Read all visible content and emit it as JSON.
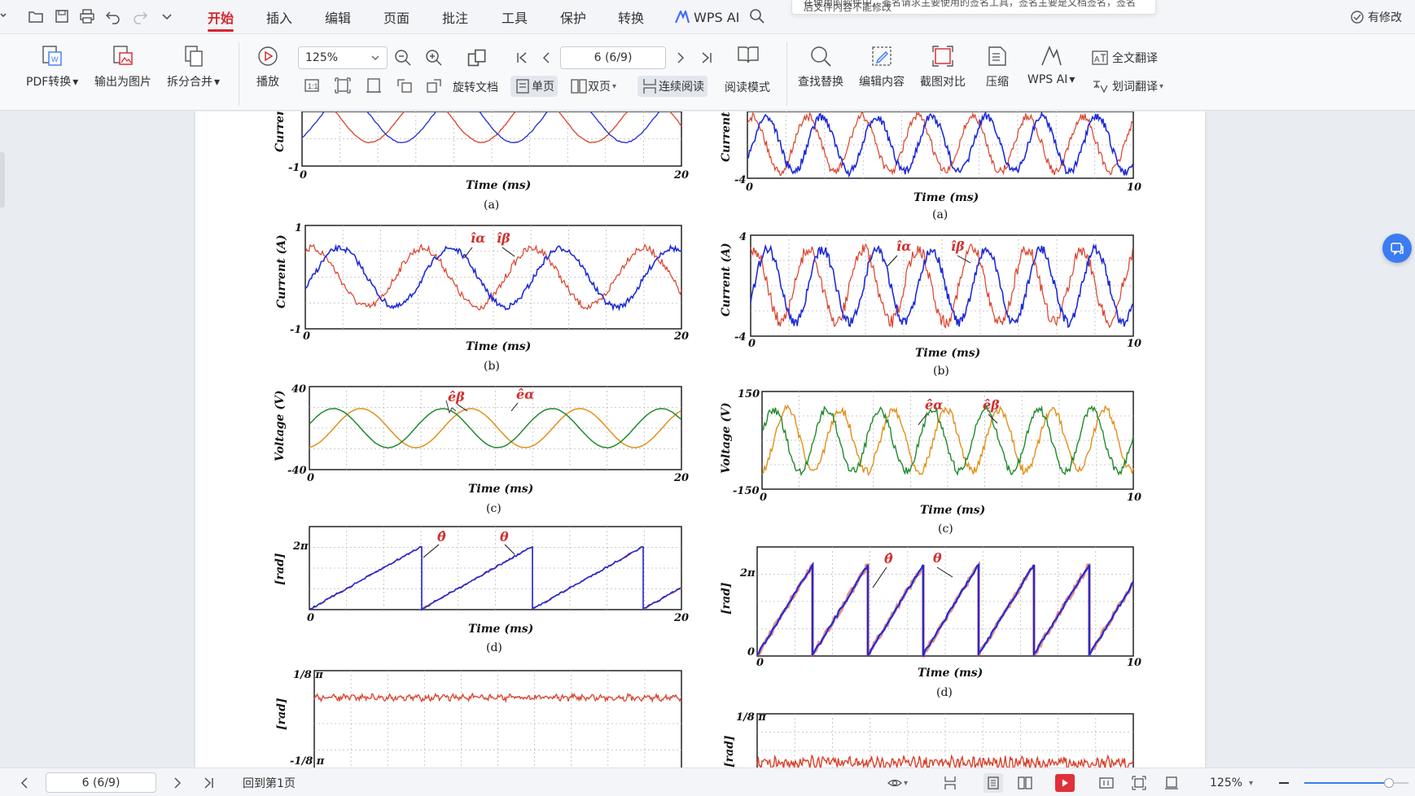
{
  "menu": {
    "tabs": [
      "开始",
      "插入",
      "编辑",
      "页面",
      "批注",
      "工具",
      "保护",
      "转换"
    ],
    "active": "开始",
    "wps_ai": "WPS AI",
    "notification": "在使用的软件中，签名请求主要使用的签名工具，签名主要是文档签名，签名后文件内容不能修改",
    "modified_status": "有修改"
  },
  "ribbon": {
    "pdf_convert": "PDF转换",
    "export_image": "输出为图片",
    "split_merge": "拆分合并",
    "play": "播放",
    "zoom_value": "125%",
    "page_value": "6 (6/9)",
    "rotate_doc": "旋转文档",
    "single_page": "单页",
    "double_page": "双页",
    "continuous_read": "连续阅读",
    "read_mode": "阅读模式",
    "find_replace": "查找替换",
    "edit_content": "编辑内容",
    "screenshot_compare": "截图对比",
    "compress": "压缩",
    "wps_ai": "WPS AI",
    "full_translate": "全文翻译",
    "word_translate": "划词翻译"
  },
  "statusbar": {
    "page_value": "6 (6/9)",
    "back_to_first": "回到第1页",
    "zoom_value": "125%",
    "zoom_level": 0.81
  },
  "colors": {
    "accent": "#d6262b",
    "blue_trace": "#1f2bd6",
    "red_trace": "#d9412b",
    "orange_trace": "#e0901a",
    "green_trace": "#1f8a2a"
  },
  "figure": {
    "left": {
      "a": {
        "ylabel": "Current",
        "ymin": "-1",
        "xmin": "0",
        "xmax": "20",
        "xlabel": "Time (ms)",
        "caption": "(a)"
      },
      "b": {
        "ylabel": "Current (A)",
        "ymax": "1",
        "ymin": "-1",
        "xmin": "0",
        "xmax": "20",
        "xlabel": "Time (ms)",
        "caption": "(b)",
        "ann1": "îα",
        "ann2": "îβ"
      },
      "c": {
        "ylabel": "Voltage (V)",
        "ymax": "40",
        "ymin": "-40",
        "xmin": "0",
        "xmax": "20",
        "xlabel": "Time (ms)",
        "caption": "(c)",
        "ann1": "êβ",
        "ann2": "êα"
      },
      "d": {
        "ylabel": "[rad]",
        "ymax": "2π",
        "xmin": "0",
        "xmax": "20",
        "xlabel": "Time (ms)",
        "caption": "(d)",
        "ann1": "θ̂",
        "ann2": "θ"
      },
      "e": {
        "ylabel": "[rad]",
        "ymax": "1/8 π",
        "ymin": "-1/8 π"
      }
    },
    "right": {
      "a": {
        "ylabel": "Current",
        "ymin": "-4",
        "xmin": "0",
        "xmax": "10",
        "xlabel": "Time (ms)",
        "caption": "(a)"
      },
      "b": {
        "ylabel": "Current (A)",
        "ymax": "4",
        "ymin": "-4",
        "xmin": "0",
        "xmax": "10",
        "xlabel": "Time (ms)",
        "caption": "(b)",
        "ann1": "îα",
        "ann2": "îβ"
      },
      "c": {
        "ylabel": "Voltage (V)",
        "ymax": "150",
        "ymin": "-150",
        "xmin": "0",
        "xmax": "10",
        "xlabel": "Time (ms)",
        "caption": "(c)",
        "ann1": "êα",
        "ann2": "êβ"
      },
      "d": {
        "ylabel": "[rad]",
        "ymax": "2π",
        "ymin": "0",
        "xmin": "0",
        "xmax": "10",
        "xlabel": "Time (ms)",
        "caption": "(d)",
        "ann1": "θ̂",
        "ann2": "θ"
      },
      "e": {
        "ylabel": "[rad]",
        "ymax": "1/8 π"
      }
    }
  }
}
